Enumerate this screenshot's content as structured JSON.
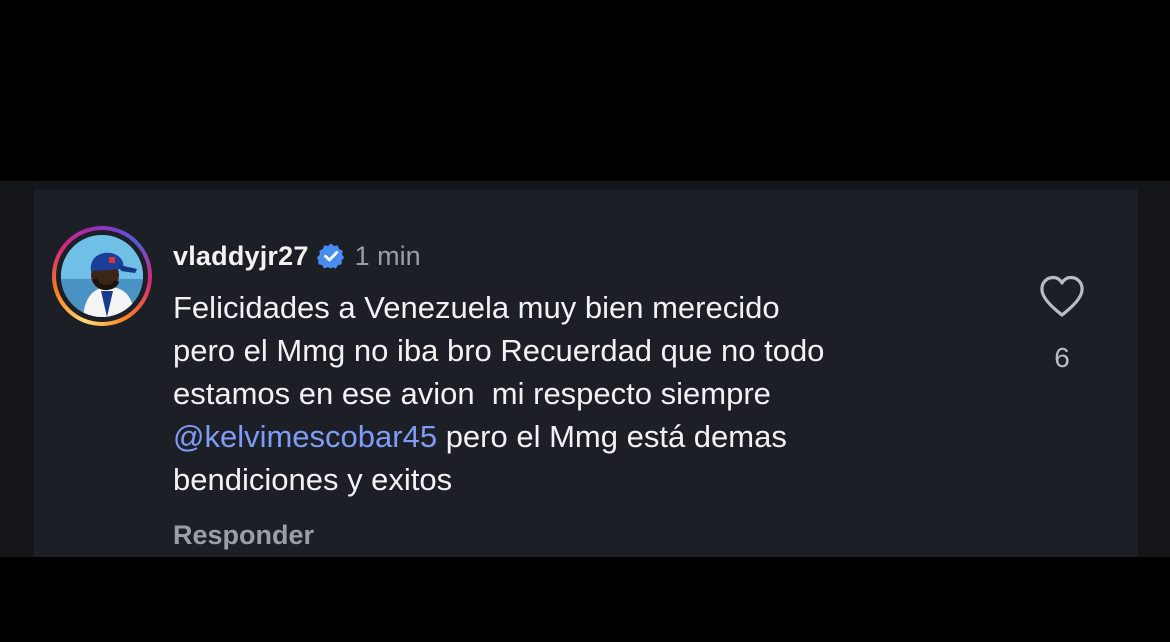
{
  "comment": {
    "username": "vladdyjr27",
    "time": "1 min",
    "text_before_mention": "Felicidades a Venezuela muy bien merecido\npero el Mmg no iba bro Recuerdad que no todo\nestamos en ese avion  mi respecto siempre\n",
    "mention": "@kelvimescobar45",
    "text_after_mention": " pero el Mmg está demas\nbendiciones y exitos",
    "reply_label": "Responder",
    "like_count": "6"
  },
  "icons": {
    "verified": "verified-badge-icon",
    "like": "heart-outline-icon"
  },
  "colors": {
    "mention": "#7e9cf5",
    "verified": "#4a8cf0",
    "card_background": "#1d1f27"
  }
}
